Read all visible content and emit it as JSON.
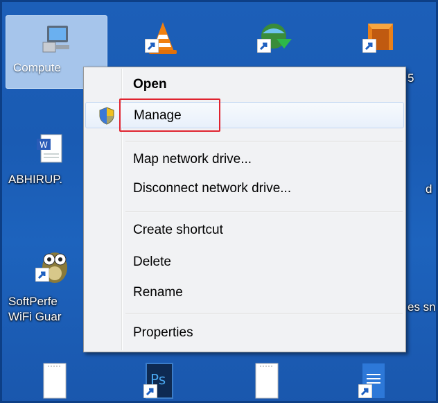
{
  "desktop": {
    "icons": [
      {
        "id": "computer",
        "label": "Compute",
        "glyph": "computer-icon"
      },
      {
        "id": "vlc",
        "label": "",
        "glyph": "vlc-cone-icon"
      },
      {
        "id": "idm",
        "label": "",
        "glyph": "download-manager-icon"
      },
      {
        "id": "box",
        "label": "5",
        "glyph": "box-app-icon"
      },
      {
        "id": "word",
        "label": "ABHIRUP.",
        "glyph": "word-document-icon"
      },
      {
        "id": "owl",
        "label": "SoftPerfe",
        "label2": "WiFi Guar",
        "glyph": "owl-app-icon"
      },
      {
        "id": "note1",
        "label": "",
        "glyph": "text-file-icon"
      },
      {
        "id": "ps",
        "label": "",
        "glyph": "photoshop-icon"
      },
      {
        "id": "note2",
        "label": "",
        "glyph": "text-file-icon"
      },
      {
        "id": "doc",
        "label": "",
        "glyph": "document-icon"
      }
    ],
    "right_labels": {
      "r1": "d",
      "r2": "es sn"
    }
  },
  "context_menu": {
    "items": [
      {
        "label": "Open"
      },
      {
        "label": "Manage"
      },
      {
        "label": "Map network drive..."
      },
      {
        "label": "Disconnect network drive..."
      },
      {
        "label": "Create shortcut"
      },
      {
        "label": "Delete"
      },
      {
        "label": "Rename"
      },
      {
        "label": "Properties"
      }
    ]
  },
  "colors": {
    "desktop": "#1c5fb8",
    "highlight_box": "#e0232f",
    "menu_bg": "#f1f2f4"
  }
}
